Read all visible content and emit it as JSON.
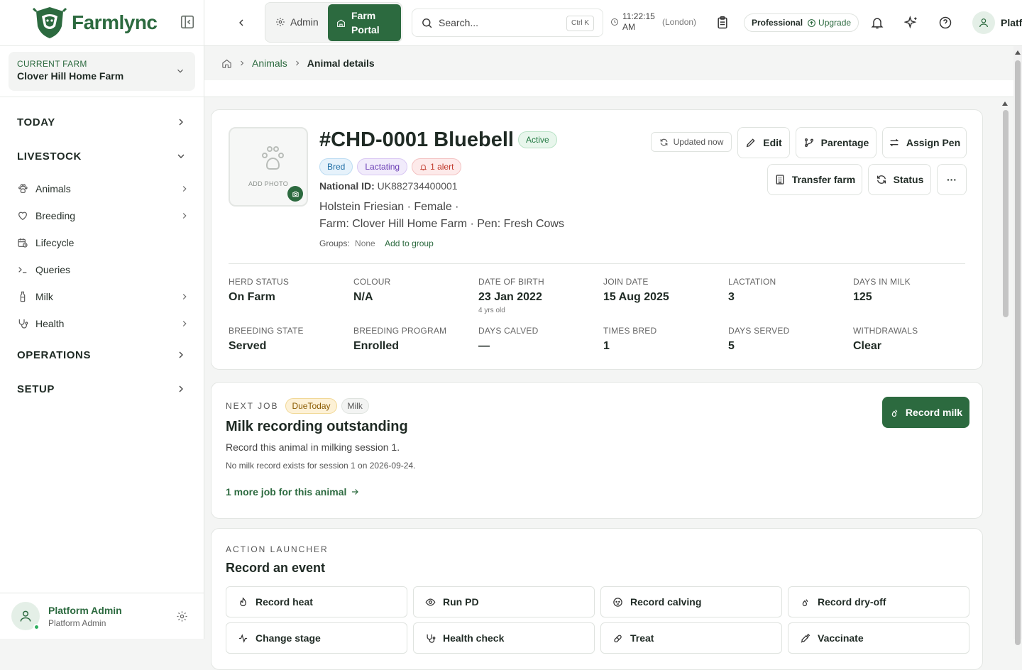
{
  "app": {
    "name": "Farmlync",
    "brand_color": "#2c6a3f"
  },
  "sidebar": {
    "farm_caption": "CURRENT FARM",
    "farm_name": "Clover Hill Home Farm",
    "sections": {
      "today": "TODAY",
      "livestock": "LIVESTOCK",
      "operations": "OPERATIONS",
      "setup": "SETUP"
    },
    "livestock_items": [
      {
        "label": "Animals",
        "icon": "paw-icon"
      },
      {
        "label": "Breeding",
        "icon": "heart-icon"
      },
      {
        "label": "Lifecycle",
        "icon": "calendar-clock-icon"
      },
      {
        "label": "Queries",
        "icon": "terminal-icon"
      },
      {
        "label": "Milk",
        "icon": "milk-bottle-icon"
      },
      {
        "label": "Health",
        "icon": "stethoscope-icon"
      }
    ],
    "user": {
      "name": "Platform Admin",
      "role": "Platform Admin"
    }
  },
  "topbar": {
    "admin_label": "Admin",
    "farm_portal_label": "Farm Portal",
    "search_placeholder": "Search...",
    "search_shortcut": "Ctrl K",
    "time": "11:22:15 AM",
    "timezone": "(London)",
    "plan": "Professional",
    "upgrade": "Upgrade",
    "user_truncated": "Platf"
  },
  "breadcrumb": {
    "animals": "Animals",
    "current": "Animal details"
  },
  "animal": {
    "title": "#CHD-0001 Bluebell",
    "status": "Active",
    "tags": {
      "bred": "Bred",
      "lactating": "Lactating",
      "alert": "1 alert"
    },
    "photo_label": "ADD PHOTO",
    "national_id_label": "National ID:",
    "national_id": "UK882734400001",
    "breed_line": "Holstein Friesian · Female ·",
    "farm_line": "Farm: Clover Hill Home Farm · Pen: Fresh Cows",
    "groups_label": "Groups:",
    "groups_value": "None",
    "add_group": "Add to group",
    "updated": "Updated now",
    "actions": {
      "edit": "Edit",
      "parentage": "Parentage",
      "assign_pen": "Assign Pen",
      "transfer": "Transfer farm",
      "status": "Status",
      "more": "···"
    },
    "stats": [
      {
        "label": "HERD STATUS",
        "value": "On Farm"
      },
      {
        "label": "COLOUR",
        "value": "N/A"
      },
      {
        "label": "DATE OF BIRTH",
        "value": "23 Jan 2022",
        "sub": "4 yrs old"
      },
      {
        "label": "JOIN DATE",
        "value": "15 Aug 2025"
      },
      {
        "label": "LACTATION",
        "value": "3"
      },
      {
        "label": "DAYS IN MILK",
        "value": "125"
      },
      {
        "label": "BREEDING STATE",
        "value": "Served"
      },
      {
        "label": "BREEDING PROGRAM",
        "value": "Enrolled"
      },
      {
        "label": "DAYS CALVED",
        "value": "—"
      },
      {
        "label": "TIMES BRED",
        "value": "1"
      },
      {
        "label": "DAYS SERVED",
        "value": "5"
      },
      {
        "label": "WITHDRAWALS",
        "value": "Clear"
      }
    ]
  },
  "next_job": {
    "caption": "NEXT JOB",
    "due": "DueToday",
    "type": "Milk",
    "title": "Milk recording outstanding",
    "desc": "Record this animal in milking session 1.",
    "note": "No milk record exists for session 1 on 2026-09-24.",
    "more": "1 more job for this animal",
    "cta": "Record milk"
  },
  "launcher": {
    "caption": "ACTION LAUNCHER",
    "title": "Record an event",
    "actions": [
      {
        "label": "Record heat",
        "icon": "flame-icon"
      },
      {
        "label": "Run PD",
        "icon": "eye-icon"
      },
      {
        "label": "Record calving",
        "icon": "baby-icon"
      },
      {
        "label": "Record dry-off",
        "icon": "droplets-icon"
      },
      {
        "label": "Change stage",
        "icon": "activity-icon"
      },
      {
        "label": "Health check",
        "icon": "stethoscope-icon"
      },
      {
        "label": "Treat",
        "icon": "pill-icon"
      },
      {
        "label": "Vaccinate",
        "icon": "syringe-icon"
      }
    ]
  }
}
